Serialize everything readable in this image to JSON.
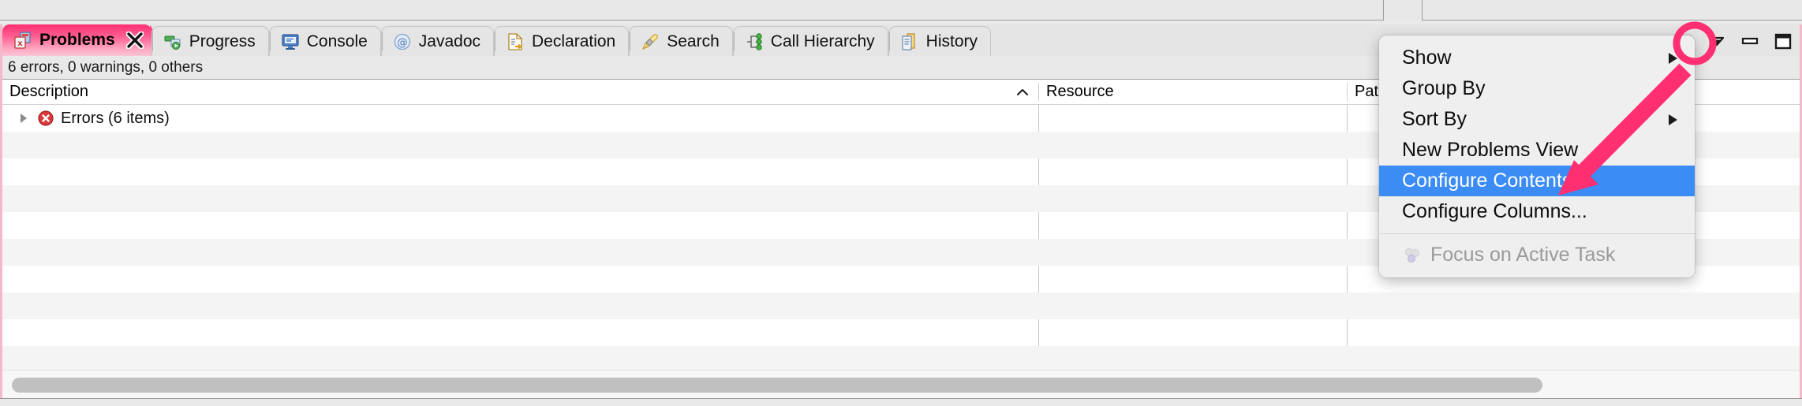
{
  "view": {
    "accent_pink": "#ff2f72",
    "selection_border": "#f3b9ca",
    "menu_highlight": "#3b8cf5"
  },
  "tabs": [
    {
      "label": "Problems",
      "icon": "problems-icon",
      "active": true,
      "closable": true
    },
    {
      "label": "Progress",
      "icon": "progress-icon",
      "active": false,
      "closable": false
    },
    {
      "label": "Console",
      "icon": "console-icon",
      "active": false,
      "closable": false
    },
    {
      "label": "Javadoc",
      "icon": "javadoc-icon",
      "active": false,
      "closable": false
    },
    {
      "label": "Declaration",
      "icon": "declaration-icon",
      "active": false,
      "closable": false
    },
    {
      "label": "Search",
      "icon": "search-icon",
      "active": false,
      "closable": false
    },
    {
      "label": "Call Hierarchy",
      "icon": "call-hierarchy-icon",
      "active": false,
      "closable": false
    },
    {
      "label": "History",
      "icon": "history-icon",
      "active": false,
      "closable": false
    }
  ],
  "toolbar": {
    "focus_task_label": "focus-on-active-task-icon",
    "view_menu_label": "view-menu-icon",
    "minimize_label": "minimize-icon",
    "maximize_label": "maximize-icon"
  },
  "status": {
    "text": "6 errors, 0 warnings, 0 others"
  },
  "table": {
    "columns": [
      {
        "label": "Description",
        "sorted": true,
        "sort_direction": "ascending"
      },
      {
        "label": "Resource",
        "sorted": false
      },
      {
        "label": "Path",
        "sorted": false
      }
    ],
    "rows": [
      {
        "description": "Errors (6 items)",
        "icon": "error-icon",
        "expanded": false,
        "resource": "",
        "path": ""
      }
    ],
    "empty_row_count": 9
  },
  "menu": {
    "items": [
      {
        "label": "Show",
        "submenu": true,
        "selected": false,
        "disabled": false,
        "icon": null
      },
      {
        "label": "Group By",
        "submenu": true,
        "selected": false,
        "disabled": false,
        "icon": null
      },
      {
        "label": "Sort By",
        "submenu": true,
        "selected": false,
        "disabled": false,
        "icon": null
      },
      {
        "label": "New Problems View",
        "submenu": false,
        "selected": false,
        "disabled": false,
        "icon": null
      },
      {
        "label": "Configure Contents...",
        "submenu": false,
        "selected": true,
        "disabled": false,
        "icon": null
      },
      {
        "label": "Configure Columns...",
        "submenu": false,
        "selected": false,
        "disabled": false,
        "icon": null
      },
      {
        "label": "Focus on Active Task",
        "submenu": false,
        "selected": false,
        "disabled": true,
        "icon": "task-icon"
      }
    ]
  },
  "scrollbar": {
    "orientation": "horizontal",
    "thumb_fraction": "0.85"
  }
}
